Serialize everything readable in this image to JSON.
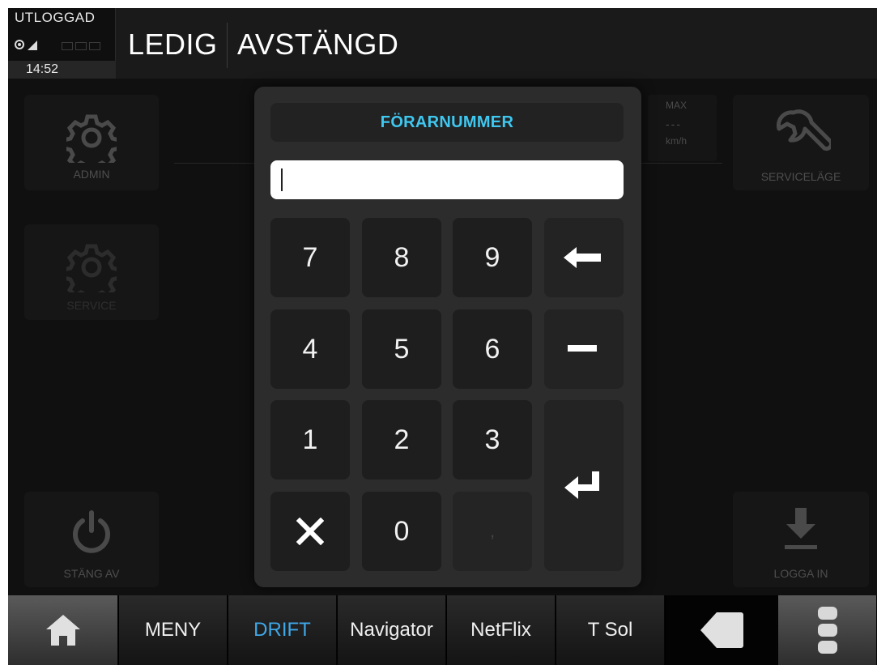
{
  "status": {
    "login_state": "UTLOGGAD",
    "time": "14:52",
    "icons": [
      "gps-icon",
      "signal-icon",
      "message-icons"
    ]
  },
  "header": {
    "state": "LEDIG",
    "mode": "AVSTÄNGD"
  },
  "tiles": {
    "admin": "ADMIN",
    "service": "SERVICE",
    "stang_av": "STÄNG AV",
    "servicelage": "SERVICELÄGE",
    "logga_in": "LOGGA IN",
    "speed_max_label": "MAX",
    "speed_value": "---",
    "speed_unit": "km/h"
  },
  "keypad": {
    "title": "FÖRARNUMMER",
    "input_value": "",
    "keys": [
      "7",
      "8",
      "9",
      "4",
      "5",
      "6",
      "1",
      "2",
      "3",
      "0",
      ","
    ],
    "backspace_icon": "arrow-left-icon",
    "minus_icon": "minus-icon",
    "enter_icon": "enter-icon",
    "cancel_icon": "close-icon"
  },
  "nav": {
    "home_icon": "home-icon",
    "items": [
      "MENY",
      "DRIFT",
      "Navigator",
      "NetFlix",
      "T Sol"
    ],
    "active": "DRIFT",
    "back_icon": "back-icon",
    "more_icon": "more-icon"
  },
  "colors": {
    "accent": "#3fc7f0",
    "nav_active": "#3fa8e8",
    "background": "#101010"
  }
}
